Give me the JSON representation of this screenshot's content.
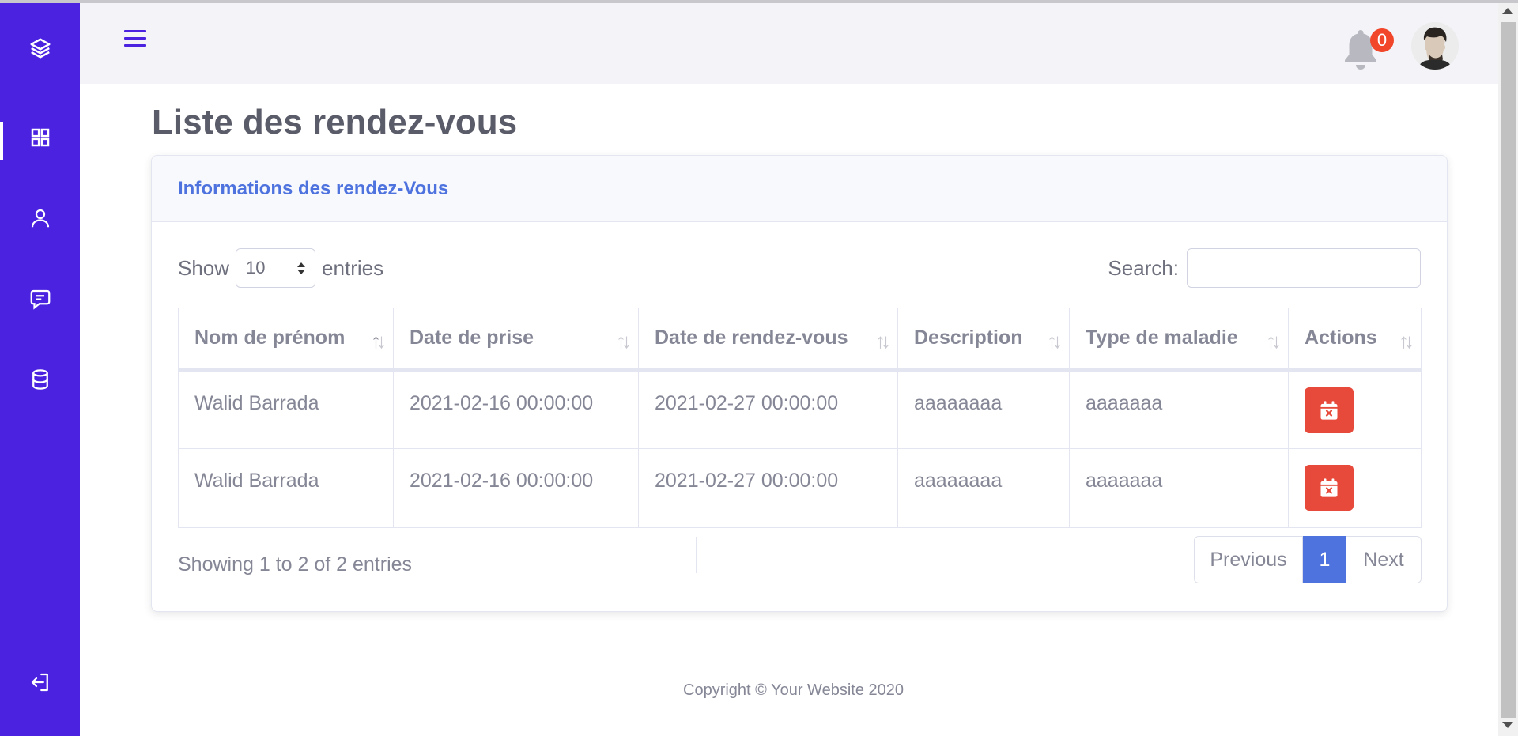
{
  "header": {
    "notification_count": "0"
  },
  "sidebar": {
    "items": [
      {
        "icon": "layers-icon"
      },
      {
        "icon": "dashboard-grid-icon",
        "active": true
      },
      {
        "icon": "user-icon"
      },
      {
        "icon": "message-icon"
      },
      {
        "icon": "database-icon"
      },
      {
        "icon": "logout-icon"
      }
    ]
  },
  "page": {
    "title": "Liste des rendez-vous"
  },
  "card": {
    "title": "Informations des rendez-Vous",
    "show_label": "Show",
    "entries_label": "entries",
    "length_value": "10",
    "search_label": "Search:",
    "search_value": ""
  },
  "table": {
    "columns": [
      "Nom de prénom",
      "Date de prise",
      "Date de rendez-vous",
      "Description",
      "Type de maladie",
      "Actions"
    ],
    "rows": [
      {
        "name": "Walid Barrada",
        "date_prise": "2021-02-16 00:00:00",
        "date_rdv": "2021-02-27 00:00:00",
        "description": "aaaaaaaa",
        "type": "aaaaaaa"
      },
      {
        "name": "Walid Barrada",
        "date_prise": "2021-02-16 00:00:00",
        "date_rdv": "2021-02-27 00:00:00",
        "description": "aaaaaaaa",
        "type": "aaaaaaa"
      }
    ]
  },
  "pagination": {
    "info": "Showing 1 to 2 of 2 entries",
    "previous": "Previous",
    "current": "1",
    "next": "Next"
  },
  "footer": {
    "copyright": "Copyright © Your Website 2020"
  },
  "colors": {
    "sidebar": "#4a22e0",
    "primary": "#4e73df",
    "danger": "#e74a3b",
    "badge": "#f1462a"
  }
}
